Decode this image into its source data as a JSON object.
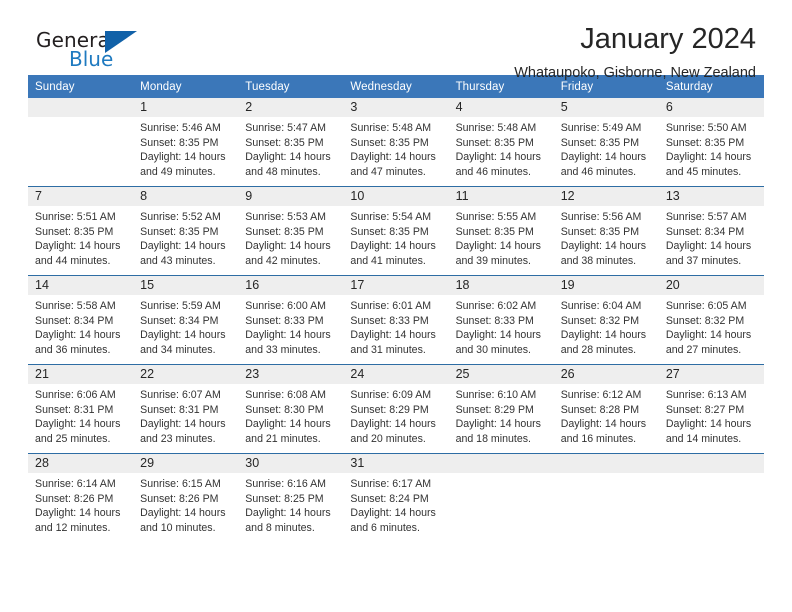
{
  "brand": {
    "general": "General",
    "blue": "Blue",
    "triangle_color": "#1161a8"
  },
  "header": {
    "month_title": "January 2024",
    "location": "Whataupoko, Gisborne, New Zealand"
  },
  "theme": {
    "header_blue": "#3b77b9",
    "row_border_blue": "#2e6da4",
    "daynum_band": "#eeeeee"
  },
  "weekdays": [
    "Sunday",
    "Monday",
    "Tuesday",
    "Wednesday",
    "Thursday",
    "Friday",
    "Saturday"
  ],
  "weeks": [
    [
      {
        "day": "",
        "sunrise": "",
        "sunset": "",
        "daylight_line1": "",
        "daylight_line2": ""
      },
      {
        "day": "1",
        "sunrise": "Sunrise: 5:46 AM",
        "sunset": "Sunset: 8:35 PM",
        "daylight_line1": "Daylight: 14 hours",
        "daylight_line2": "and 49 minutes."
      },
      {
        "day": "2",
        "sunrise": "Sunrise: 5:47 AM",
        "sunset": "Sunset: 8:35 PM",
        "daylight_line1": "Daylight: 14 hours",
        "daylight_line2": "and 48 minutes."
      },
      {
        "day": "3",
        "sunrise": "Sunrise: 5:48 AM",
        "sunset": "Sunset: 8:35 PM",
        "daylight_line1": "Daylight: 14 hours",
        "daylight_line2": "and 47 minutes."
      },
      {
        "day": "4",
        "sunrise": "Sunrise: 5:48 AM",
        "sunset": "Sunset: 8:35 PM",
        "daylight_line1": "Daylight: 14 hours",
        "daylight_line2": "and 46 minutes."
      },
      {
        "day": "5",
        "sunrise": "Sunrise: 5:49 AM",
        "sunset": "Sunset: 8:35 PM",
        "daylight_line1": "Daylight: 14 hours",
        "daylight_line2": "and 46 minutes."
      },
      {
        "day": "6",
        "sunrise": "Sunrise: 5:50 AM",
        "sunset": "Sunset: 8:35 PM",
        "daylight_line1": "Daylight: 14 hours",
        "daylight_line2": "and 45 minutes."
      }
    ],
    [
      {
        "day": "7",
        "sunrise": "Sunrise: 5:51 AM",
        "sunset": "Sunset: 8:35 PM",
        "daylight_line1": "Daylight: 14 hours",
        "daylight_line2": "and 44 minutes."
      },
      {
        "day": "8",
        "sunrise": "Sunrise: 5:52 AM",
        "sunset": "Sunset: 8:35 PM",
        "daylight_line1": "Daylight: 14 hours",
        "daylight_line2": "and 43 minutes."
      },
      {
        "day": "9",
        "sunrise": "Sunrise: 5:53 AM",
        "sunset": "Sunset: 8:35 PM",
        "daylight_line1": "Daylight: 14 hours",
        "daylight_line2": "and 42 minutes."
      },
      {
        "day": "10",
        "sunrise": "Sunrise: 5:54 AM",
        "sunset": "Sunset: 8:35 PM",
        "daylight_line1": "Daylight: 14 hours",
        "daylight_line2": "and 41 minutes."
      },
      {
        "day": "11",
        "sunrise": "Sunrise: 5:55 AM",
        "sunset": "Sunset: 8:35 PM",
        "daylight_line1": "Daylight: 14 hours",
        "daylight_line2": "and 39 minutes."
      },
      {
        "day": "12",
        "sunrise": "Sunrise: 5:56 AM",
        "sunset": "Sunset: 8:35 PM",
        "daylight_line1": "Daylight: 14 hours",
        "daylight_line2": "and 38 minutes."
      },
      {
        "day": "13",
        "sunrise": "Sunrise: 5:57 AM",
        "sunset": "Sunset: 8:34 PM",
        "daylight_line1": "Daylight: 14 hours",
        "daylight_line2": "and 37 minutes."
      }
    ],
    [
      {
        "day": "14",
        "sunrise": "Sunrise: 5:58 AM",
        "sunset": "Sunset: 8:34 PM",
        "daylight_line1": "Daylight: 14 hours",
        "daylight_line2": "and 36 minutes."
      },
      {
        "day": "15",
        "sunrise": "Sunrise: 5:59 AM",
        "sunset": "Sunset: 8:34 PM",
        "daylight_line1": "Daylight: 14 hours",
        "daylight_line2": "and 34 minutes."
      },
      {
        "day": "16",
        "sunrise": "Sunrise: 6:00 AM",
        "sunset": "Sunset: 8:33 PM",
        "daylight_line1": "Daylight: 14 hours",
        "daylight_line2": "and 33 minutes."
      },
      {
        "day": "17",
        "sunrise": "Sunrise: 6:01 AM",
        "sunset": "Sunset: 8:33 PM",
        "daylight_line1": "Daylight: 14 hours",
        "daylight_line2": "and 31 minutes."
      },
      {
        "day": "18",
        "sunrise": "Sunrise: 6:02 AM",
        "sunset": "Sunset: 8:33 PM",
        "daylight_line1": "Daylight: 14 hours",
        "daylight_line2": "and 30 minutes."
      },
      {
        "day": "19",
        "sunrise": "Sunrise: 6:04 AM",
        "sunset": "Sunset: 8:32 PM",
        "daylight_line1": "Daylight: 14 hours",
        "daylight_line2": "and 28 minutes."
      },
      {
        "day": "20",
        "sunrise": "Sunrise: 6:05 AM",
        "sunset": "Sunset: 8:32 PM",
        "daylight_line1": "Daylight: 14 hours",
        "daylight_line2": "and 27 minutes."
      }
    ],
    [
      {
        "day": "21",
        "sunrise": "Sunrise: 6:06 AM",
        "sunset": "Sunset: 8:31 PM",
        "daylight_line1": "Daylight: 14 hours",
        "daylight_line2": "and 25 minutes."
      },
      {
        "day": "22",
        "sunrise": "Sunrise: 6:07 AM",
        "sunset": "Sunset: 8:31 PM",
        "daylight_line1": "Daylight: 14 hours",
        "daylight_line2": "and 23 minutes."
      },
      {
        "day": "23",
        "sunrise": "Sunrise: 6:08 AM",
        "sunset": "Sunset: 8:30 PM",
        "daylight_line1": "Daylight: 14 hours",
        "daylight_line2": "and 21 minutes."
      },
      {
        "day": "24",
        "sunrise": "Sunrise: 6:09 AM",
        "sunset": "Sunset: 8:29 PM",
        "daylight_line1": "Daylight: 14 hours",
        "daylight_line2": "and 20 minutes."
      },
      {
        "day": "25",
        "sunrise": "Sunrise: 6:10 AM",
        "sunset": "Sunset: 8:29 PM",
        "daylight_line1": "Daylight: 14 hours",
        "daylight_line2": "and 18 minutes."
      },
      {
        "day": "26",
        "sunrise": "Sunrise: 6:12 AM",
        "sunset": "Sunset: 8:28 PM",
        "daylight_line1": "Daylight: 14 hours",
        "daylight_line2": "and 16 minutes."
      },
      {
        "day": "27",
        "sunrise": "Sunrise: 6:13 AM",
        "sunset": "Sunset: 8:27 PM",
        "daylight_line1": "Daylight: 14 hours",
        "daylight_line2": "and 14 minutes."
      }
    ],
    [
      {
        "day": "28",
        "sunrise": "Sunrise: 6:14 AM",
        "sunset": "Sunset: 8:26 PM",
        "daylight_line1": "Daylight: 14 hours",
        "daylight_line2": "and 12 minutes."
      },
      {
        "day": "29",
        "sunrise": "Sunrise: 6:15 AM",
        "sunset": "Sunset: 8:26 PM",
        "daylight_line1": "Daylight: 14 hours",
        "daylight_line2": "and 10 minutes."
      },
      {
        "day": "30",
        "sunrise": "Sunrise: 6:16 AM",
        "sunset": "Sunset: 8:25 PM",
        "daylight_line1": "Daylight: 14 hours",
        "daylight_line2": "and 8 minutes."
      },
      {
        "day": "31",
        "sunrise": "Sunrise: 6:17 AM",
        "sunset": "Sunset: 8:24 PM",
        "daylight_line1": "Daylight: 14 hours",
        "daylight_line2": "and 6 minutes."
      },
      {
        "day": "",
        "sunrise": "",
        "sunset": "",
        "daylight_line1": "",
        "daylight_line2": ""
      },
      {
        "day": "",
        "sunrise": "",
        "sunset": "",
        "daylight_line1": "",
        "daylight_line2": ""
      },
      {
        "day": "",
        "sunrise": "",
        "sunset": "",
        "daylight_line1": "",
        "daylight_line2": ""
      }
    ]
  ]
}
